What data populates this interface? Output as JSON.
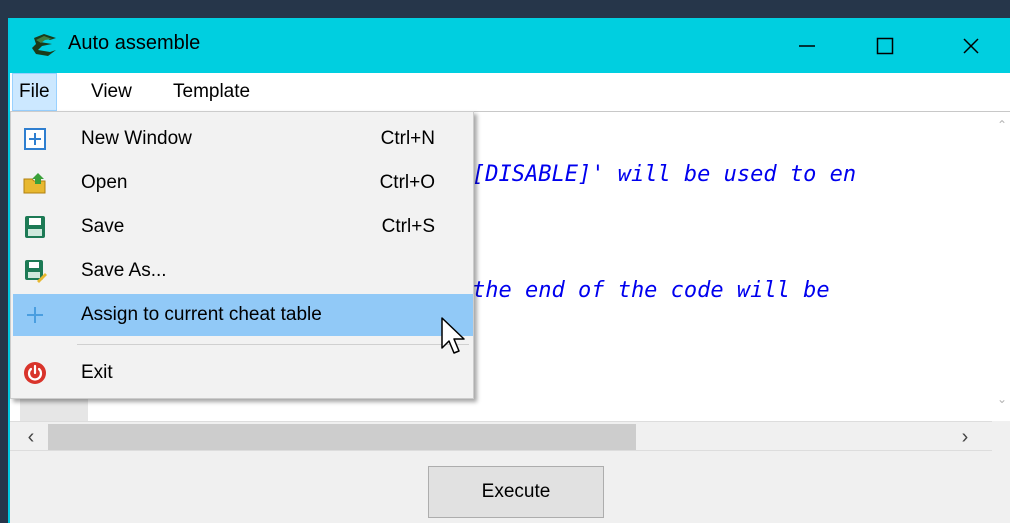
{
  "window": {
    "title": "Auto assemble"
  },
  "menubar": {
    "items": [
      "File",
      "View",
      "Template"
    ]
  },
  "editor": {
    "lines": [
      "[DISABLE]' will be used to en",
      "the end of the code will be"
    ]
  },
  "file_menu": {
    "items": [
      {
        "label": "New Window",
        "shortcut": "Ctrl+N",
        "icon": "new-window-icon"
      },
      {
        "label": "Open",
        "shortcut": "Ctrl+O",
        "icon": "open-folder-icon"
      },
      {
        "label": "Save",
        "shortcut": "Ctrl+S",
        "icon": "save-icon"
      },
      {
        "label": "Save As...",
        "shortcut": "",
        "icon": "save-as-icon"
      },
      {
        "label": "Assign to current cheat table",
        "shortcut": "",
        "icon": "plus-icon"
      },
      {
        "label": "Exit",
        "shortcut": "",
        "icon": "power-icon"
      }
    ],
    "highlighted_index": 4
  },
  "buttons": {
    "execute": "Execute"
  },
  "colors": {
    "titlebar": "#00cfe0",
    "menu_highlight": "#91c9f7",
    "code_text": "#0000ee",
    "desktop": "#26364a"
  }
}
